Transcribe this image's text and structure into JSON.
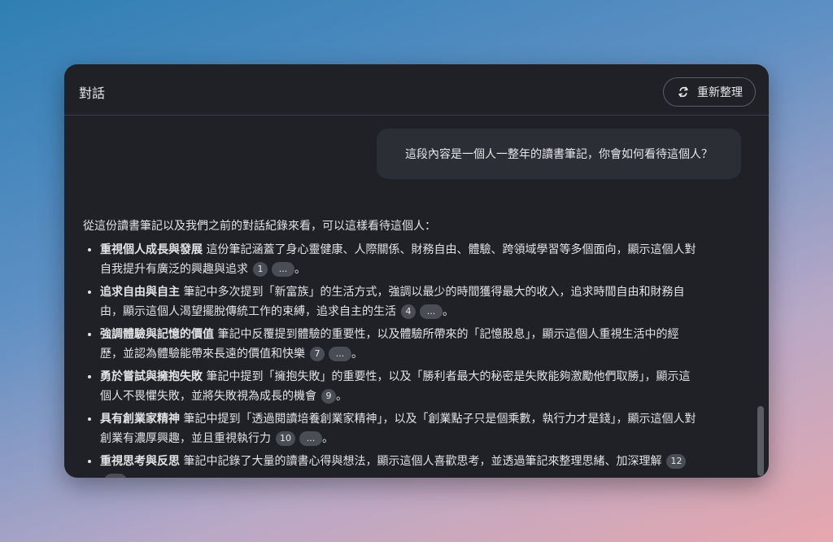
{
  "window": {
    "title": "對話",
    "regenerate_label": "重新整理"
  },
  "user_message": "這段內容是一個人一整年的讀書筆記，你會如何看待這個人？",
  "assistant": {
    "intro": "從這份讀書筆記以及我們之前的對話紀錄來看，可以這樣看待這個人：",
    "items": [
      {
        "title": "重視個人成長與發展",
        "text": " 這份筆記涵蓋了身心靈健康、人際關係、財務自由、體驗、跨領域學習等多個面向，顯示這個人對自我提升有廣泛的興趣與追求",
        "cite": "1",
        "more": "...",
        "end": "。"
      },
      {
        "title": "追求自由與自主",
        "text": " 筆記中多次提到「新富族」的生活方式，強調以最少的時間獲得最大的收入，追求時間自由和財務自由，顯示這個人渴望擺脫傳統工作的束縛，追求自主的生活",
        "cite": "4",
        "more": "...",
        "end": "。"
      },
      {
        "title": "強調體驗與記憶的價值",
        "text": " 筆記中反覆提到體驗的重要性，以及體驗所帶來的「記憶股息」，顯示這個人重視生活中的經歷，並認為體驗能帶來長遠的價值和快樂",
        "cite": "7",
        "more": "...",
        "end": "。"
      },
      {
        "title": "勇於嘗試與擁抱失敗",
        "text": " 筆記中提到「擁抱失敗」的重要性，以及「勝利者最大的秘密是失敗能夠激勵他們取勝」，顯示這個人不畏懼失敗，並將失敗視為成長的機會",
        "cite": "9",
        "more": "",
        "end": "。"
      },
      {
        "title": "具有創業家精神",
        "text": " 筆記中提到「透過閱讀培養創業家精神」，以及「創業點子只是個乘數，執行力才是錢」，顯示這個人對創業有濃厚興趣，並且重視執行力",
        "cite": "10",
        "more": "...",
        "end": "。"
      },
      {
        "title": "重視思考與反思",
        "text": " 筆記中記錄了大量的讀書心得與想法，顯示這個人喜歡思考，並透過筆記來整理思緒、加深理解",
        "cite": "12",
        "more": "...",
        "end": "。"
      }
    ]
  },
  "icons": {
    "regenerate": "refresh-icon"
  }
}
